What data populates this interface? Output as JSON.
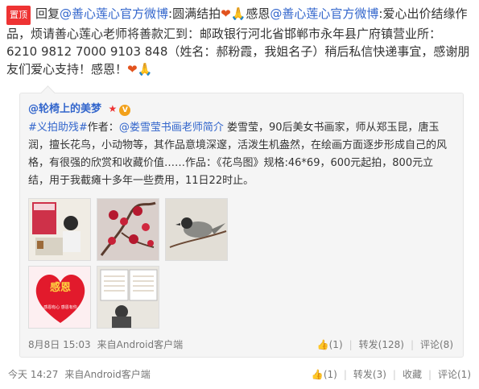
{
  "post": {
    "pin_label": "置顶",
    "line1_prefix": "回复",
    "mention1": "@善心莲心官方微博",
    "line1_mid": ":圆满结拍",
    "line1_mid2": "感恩",
    "mention2": "@善心莲心官方微博",
    "line1_rest": ":爱心出价结缘作品，烦请善心莲心老师将善款汇到：邮政银行河北省邯郸市永年县广府镇营业所：6210 9812 7000 9103 848（姓名：郝粉霞，我姐名子）稍后私信快递事宜，感谢朋友们爱心支持！感恩！",
    "emoji_heart": "❤",
    "emoji_pray": "🙏"
  },
  "repost": {
    "author": "@轮椅上的美梦",
    "body_tag": "#义拍助残#",
    "body_pre": "作者：",
    "mention": "@娄雪莹书画老师简介",
    "body_main": " 娄雪莹，90后美女书画家，师从郑玉昆，唐玉润，擅长花鸟，小动物等，其作品意境深邃，活泼生机盎然，在绘画方面逐步形成自己的风格，有很强的欣赏和收藏价值……作品：《花鸟图》规格:46*69，600元起拍，800元立结，用于我截瘫十多年一些费用，11日22时止。",
    "timestamp": "8月8日 15:03",
    "source": "来自Android客户端",
    "like_count": "(1)",
    "repost_label": "转发(128)",
    "comment_label": "评论(8)"
  },
  "footer": {
    "timestamp": "今天 14:27",
    "source": "来自Android客户端",
    "like_count": "(1)",
    "repost_label": "转发(3)",
    "favorite_label": "收藏",
    "comment_label": "评论(1)"
  },
  "thumbs": {
    "heart_text": "感恩",
    "heart_sub": "感恩有心 感恩有你"
  }
}
